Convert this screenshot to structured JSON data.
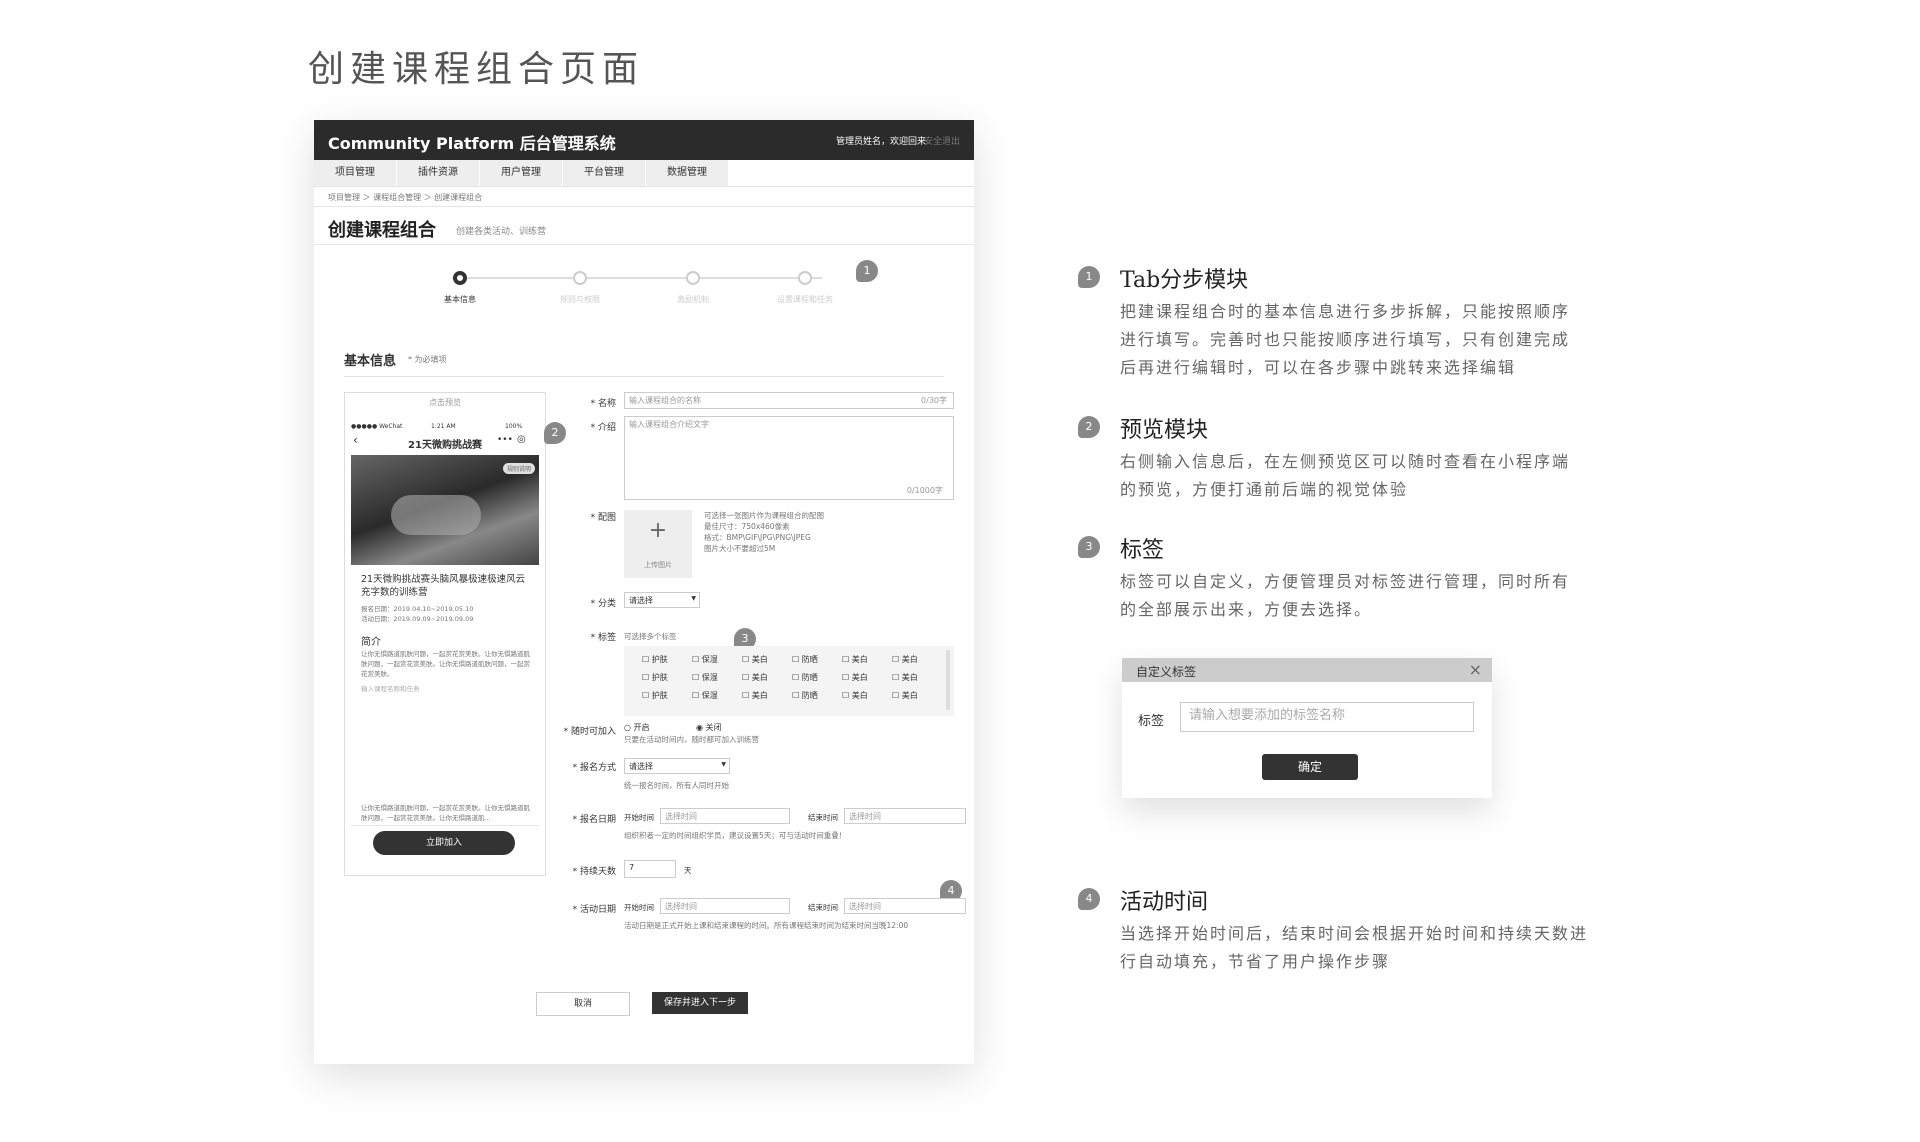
{
  "page_title": "创建课程组合页面",
  "app": {
    "title": "Community Platform 后台管理系统",
    "user": "管理员姓名，欢迎回来",
    "logout": "安全退出"
  },
  "nav": [
    "项目管理",
    "插件资源",
    "用户管理",
    "平台管理",
    "数据管理"
  ],
  "breadcrumb": "项目管理 ＞ 课程组合管理 ＞ 创建课程组合",
  "heading": {
    "title": "创建课程组合",
    "subtitle": "创建各类活动、训练营"
  },
  "steps": [
    "基本信息",
    "规则与权限",
    "激励机制",
    "设置课程和任务"
  ],
  "section": {
    "title": "基本信息",
    "note": "* 为必填项"
  },
  "preview": {
    "header": "点击预览",
    "status_left": "●●●●● WeChat",
    "status_time": "1:21 AM",
    "status_right": "100%",
    "nav_title": "21天微购挑战赛",
    "rules_tag": "规则说明",
    "course_title": "21天微购挑战赛头脑风暴极速极速风云充字数的训练营",
    "signup_date": "报名日期：2019.04.10~2019.05.10",
    "activity_date": "活动日期：2019.09.09~2019.09.09",
    "intro_title": "简介",
    "intro_text": "让你无惧路道肌肤问题，一起赏花赏美肤。让你无惧路道肌肤问题，一起赏花赏美肤。让你无惧路道肌肤问题，一起赏花赏美肤。",
    "intro_placeholder": "输入课程名称和任务",
    "footer_text": "让你无惧路道肌肤问题，一起赏花赏美肤。让你无惧路道肌肤问题，一起赏花赏美肤。让你无惧路道肌...",
    "join_button": "立即加入"
  },
  "form": {
    "name_label": "* 名称",
    "name_placeholder": "输入课程组合的名称",
    "name_count": "0/30字",
    "intro_label": "* 介绍",
    "intro_placeholder": "输入课程组合介绍文字",
    "intro_count": "0/1000字",
    "image_label": "* 配图",
    "upload_label": "上传图片",
    "image_note": [
      "可选择一张图片作为课程组合的配图",
      "最佳尺寸：750x460像素",
      "格式：BMP\\GIF\\JPG\\PNG\\JPEG",
      "图片大小不要超过5M"
    ],
    "category_label": "* 分类",
    "category_value": "请选择",
    "tags_label": "* 标签",
    "tags_note": "可选择多个标签",
    "tag_rows": [
      [
        "护肤",
        "保湿",
        "美白",
        "防晒",
        "美白",
        "美白"
      ],
      [
        "护肤",
        "保湿",
        "美白",
        "防晒",
        "美白",
        "美白"
      ],
      [
        "护肤",
        "保湿",
        "美白",
        "防晒",
        "美白",
        "美白"
      ]
    ],
    "join_label": "* 随时可加入",
    "join_on": "开启",
    "join_off": "关闭",
    "join_note": "只要在活动时间内，随时都可加入训练营",
    "signup_method_label": "* 报名方式",
    "signup_method_value": "请选择",
    "signup_method_note": "统一报名时间，所有人同时开始",
    "signup_date_label": "* 报名日期",
    "start_label": "开始时间",
    "end_label": "结束时间",
    "date_placeholder": "选择时间",
    "signup_date_note": "组织积者一定的时间组织学员，建议设置5天；可与活动时间重叠！",
    "duration_label": "* 持续天数",
    "duration_value": "7",
    "duration_unit": "天",
    "activity_date_label": "* 活动日期",
    "activity_date_note": "活动日期是正式开始上课和结束课程的时间。所有课程结束时间为结束时间当晚12:00",
    "cancel": "取消",
    "submit": "保存并进入下一步"
  },
  "badges": [
    "1",
    "2",
    "3",
    "4"
  ],
  "annotations": [
    {
      "num": "1",
      "title": "Tab分步模块",
      "lines": [
        "把建课程组合时的基本信息进行多步拆解，只能按照顺序",
        "进行填写。完善时也只能按顺序进行填写，只有创建完成",
        "后再进行编辑时，可以在各步骤中跳转来选择编辑"
      ]
    },
    {
      "num": "2",
      "title": "预览模块",
      "lines": [
        "右侧输入信息后，在左侧预览区可以随时查看在小程序端",
        "的预览，方便打通前后端的视觉体验"
      ]
    },
    {
      "num": "3",
      "title": "标签",
      "lines": [
        "标签可以自定义，方便管理员对标签进行管理，同时所有",
        "的全部展示出来，方便去选择。"
      ]
    },
    {
      "num": "4",
      "title": "活动时间",
      "lines": [
        "当选择开始时间后，结束时间会根据开始时间和持续天数进",
        "行自动填充，节省了用户操作步骤"
      ]
    }
  ],
  "dialog": {
    "title": "自定义标签",
    "close": "×",
    "label": "标签",
    "placeholder": "请输入想要添加的标签名称",
    "confirm": "确定"
  }
}
